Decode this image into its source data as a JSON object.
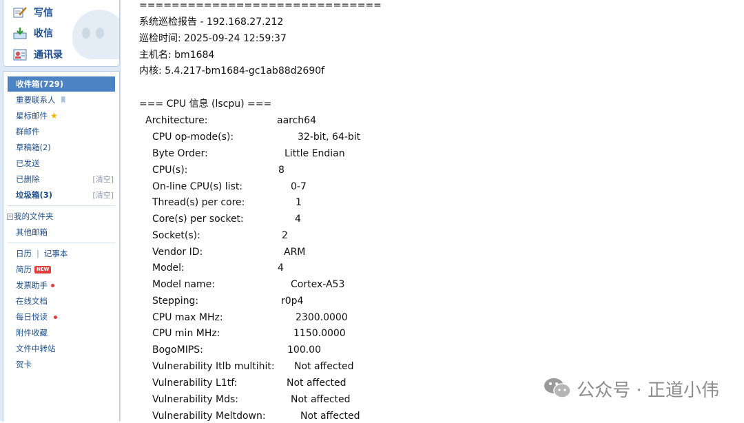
{
  "sidebar": {
    "actions": [
      {
        "label": "写信",
        "icon": "compose-icon"
      },
      {
        "label": "收信",
        "icon": "inbox-download-icon"
      },
      {
        "label": "通讯录",
        "icon": "contacts-icon"
      }
    ],
    "folders": {
      "inbox": "收件箱(729)",
      "important": "重要联系人",
      "starred": "星标邮件",
      "group": "群邮件",
      "drafts": "草稿箱(2)",
      "sent": "已发送",
      "deleted": "已删除",
      "spam": "垃圾箱(3)",
      "clear": "[清空]",
      "my_folders": "我的文件夹",
      "other_mailbox": "其他邮箱"
    },
    "tools": {
      "calendar": "日历",
      "divider": "|",
      "notebook": "记事本",
      "resume": "简历",
      "new_badge": "NEW",
      "invoice": "发票助手",
      "docs": "在线文档",
      "daily_read": "每日悦读",
      "attachments": "附件收藏",
      "transfer": "文件中转站",
      "greeting": "贺卡"
    }
  },
  "report": {
    "separator": "==============================",
    "title": "系统巡检报告 - 192.168.27.212",
    "time": "巡检时间: 2025-09-24 12:59:37",
    "hostname": "主机名: bm1684",
    "kernel": "内核: 5.4.217-bm1684-gc1ab88d2690f",
    "cpu_header": "=== CPU 信息 (lscpu) ===",
    "cpu_rows": [
      {
        "key": "Architecture:",
        "value": "aarch64"
      },
      {
        "key": "CPU op-mode(s):",
        "value": "32-bit, 64-bit"
      },
      {
        "key": "Byte Order:",
        "value": "Little Endian"
      },
      {
        "key": "CPU(s):",
        "value": "8"
      },
      {
        "key": "On-line CPU(s) list:",
        "value": "0-7"
      },
      {
        "key": "Thread(s) per core:",
        "value": "1"
      },
      {
        "key": "Core(s) per socket:",
        "value": "4"
      },
      {
        "key": "Socket(s):",
        "value": "2"
      },
      {
        "key": "Vendor ID:",
        "value": "ARM"
      },
      {
        "key": "Model:",
        "value": "4"
      },
      {
        "key": "Model name:",
        "value": "Cortex-A53"
      },
      {
        "key": "Stepping:",
        "value": "r0p4"
      },
      {
        "key": "CPU max MHz:",
        "value": "2300.0000"
      },
      {
        "key": "CPU min MHz:",
        "value": "1150.0000"
      },
      {
        "key": "BogoMIPS:",
        "value": "100.00"
      },
      {
        "key": "Vulnerability Itlb multihit:",
        "value": "Not affected"
      },
      {
        "key": "Vulnerability L1tf:",
        "value": "Not affected"
      },
      {
        "key": "Vulnerability Mds:",
        "value": "Not affected"
      },
      {
        "key": "Vulnerability Meltdown:",
        "value": "Not affected"
      }
    ]
  },
  "watermark": {
    "text": "公众号 · 正道小伟",
    "icon": "wechat-icon"
  }
}
